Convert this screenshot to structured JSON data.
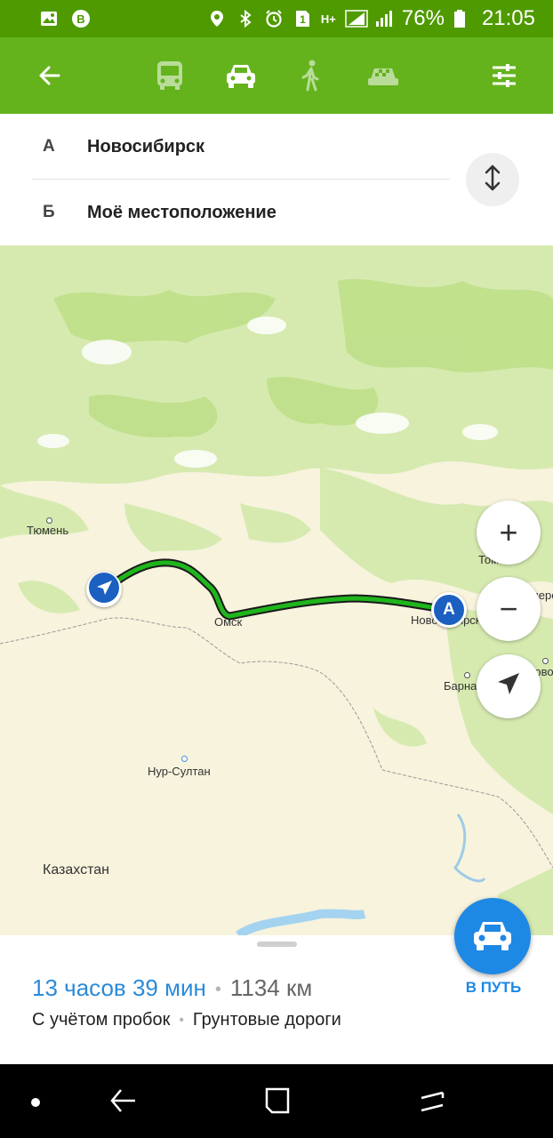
{
  "status_bar": {
    "battery": "76%",
    "time": "21:05",
    "sim": "1",
    "network": "H+",
    "icons": [
      "image-icon",
      "b-icon",
      "location-icon",
      "bluetooth-icon",
      "alarm-icon",
      "sim-icon",
      "signal-icon",
      "battery-icon"
    ]
  },
  "toolbar": {
    "back_icon": "back-arrow-icon",
    "modes": [
      "bus-icon",
      "car-icon",
      "walk-icon",
      "taxi-icon"
    ],
    "active_mode": "car-icon",
    "filters_icon": "filters-icon",
    "colors": {
      "status_bg": "#4f9a00",
      "toolbar_bg": "#64b31c"
    }
  },
  "route": {
    "from_letter": "А",
    "from": "Новосибирск",
    "to_letter": "Б",
    "to": "Моё местоположение",
    "swap_icon": "swap-vertical-icon"
  },
  "map": {
    "cities": [
      {
        "name": "Тюмень"
      },
      {
        "name": "Омск"
      },
      {
        "name": "Новосибирск"
      },
      {
        "name": "Томск"
      },
      {
        "name": "Барнаул"
      },
      {
        "name": "Кемерово"
      },
      {
        "name": "Новокузнецк"
      },
      {
        "name": "Нур-Султан"
      }
    ],
    "country": "Казахстан",
    "marker_a": "A",
    "route_color": "#1fb51c",
    "zoom_in": "+",
    "zoom_out": "−"
  },
  "summary": {
    "duration": "13 часов 39 мин",
    "separator": "•",
    "distance": "1134 км",
    "traffic": "С учётом пробок",
    "road_type": "Грунтовые дороги"
  },
  "go": {
    "label": "В ПУТЬ",
    "accent": "#1e88e5"
  }
}
